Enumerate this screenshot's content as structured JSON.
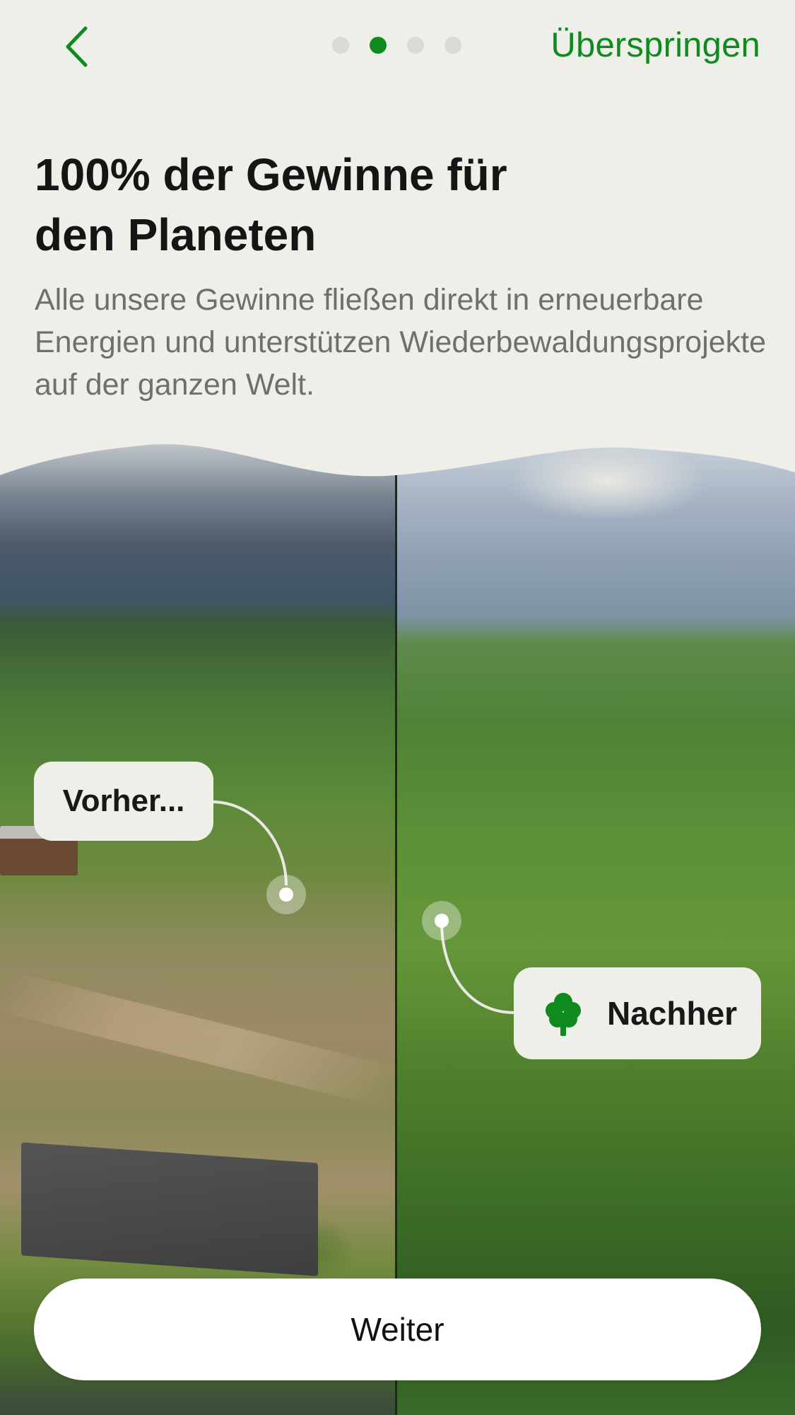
{
  "header": {
    "back_icon": "chevron-left-icon",
    "pagination": {
      "total": 4,
      "active_index": 1
    },
    "skip_label": "Überspringen"
  },
  "content": {
    "title_line1": "100% der Gewinne für",
    "title_line2": "den Planeten",
    "subtitle": "Alle unsere Gewinne fließen direkt in erneuerbare Energien und unterstützen Wiederbewaldungsprojekte auf der ganzen Welt."
  },
  "comparison": {
    "before_label": "Vorher...",
    "after_label": "Nachher",
    "after_icon": "tree-icon"
  },
  "cta": {
    "label": "Weiter"
  },
  "colors": {
    "accent": "#0f8a1f",
    "background": "#efefea",
    "card": "#efefea"
  }
}
